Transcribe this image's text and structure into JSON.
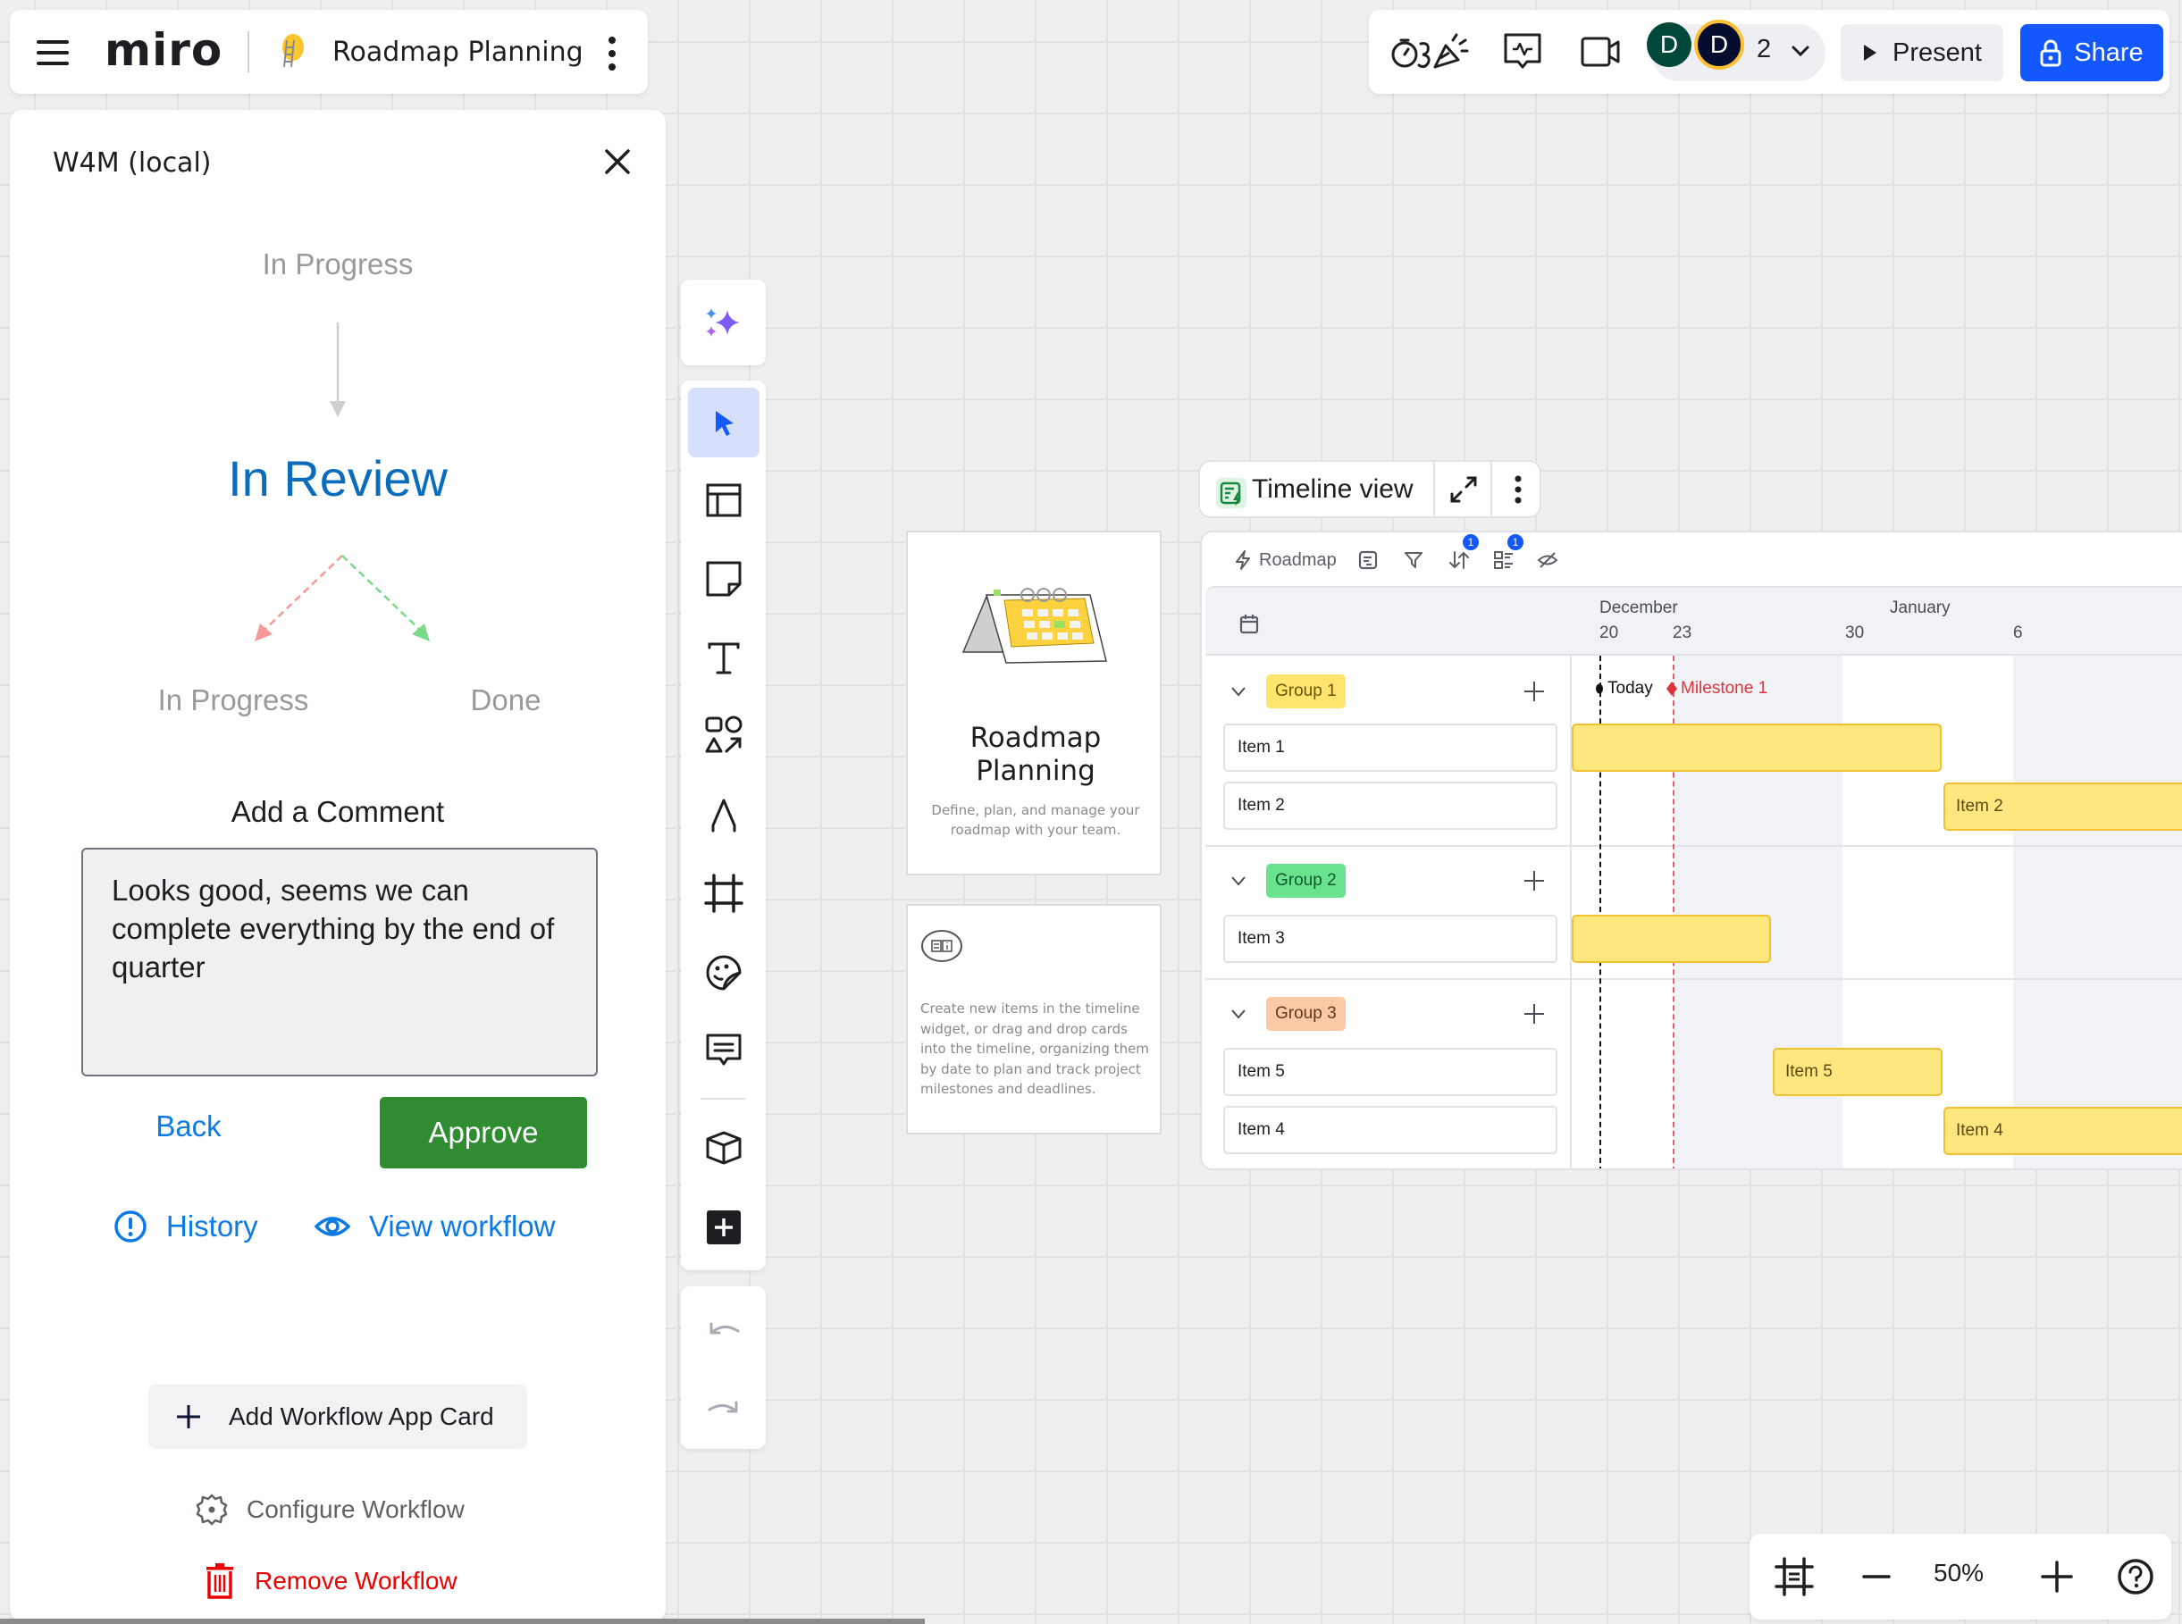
{
  "topbar": {
    "logo": "miro",
    "board_title": "Roadmap Planning"
  },
  "panel": {
    "title": "W4M (local)",
    "previous_state": "In Progress",
    "current_state": "In Review",
    "next_states": [
      {
        "label": "In Progress",
        "color": "#f49a9a"
      },
      {
        "label": "Done",
        "color": "#7bd98a"
      }
    ],
    "comment_label": "Add a Comment",
    "comment_value": "Looks good, seems we can complete everything by the end of quarter",
    "back_label": "Back",
    "approve_label": "Approve",
    "history_label": "History",
    "view_workflow_label": "View workflow",
    "add_card_label": "Add Workflow App Card",
    "configure_label": "Configure Workflow",
    "remove_label": "Remove Workflow",
    "colors": {
      "primary_link": "#0b7ae6",
      "approve": "#2f8c30",
      "danger": "#ee0000",
      "state_active": "#0a6cbd"
    }
  },
  "tools": {
    "ai": "sparkle-icon",
    "items": [
      {
        "name": "select",
        "icon": "pointer-icon",
        "active": true
      },
      {
        "name": "templates",
        "icon": "layout-icon"
      },
      {
        "name": "sticky-note",
        "icon": "sticky-note-icon"
      },
      {
        "name": "text",
        "icon": "text-icon"
      },
      {
        "name": "shapes",
        "icon": "shapes-icon"
      },
      {
        "name": "pen",
        "icon": "pen-icon"
      },
      {
        "name": "frame",
        "icon": "frame-icon"
      },
      {
        "name": "stickers",
        "icon": "sticker-icon"
      },
      {
        "name": "comment",
        "icon": "comment-icon"
      },
      {
        "name": "apps",
        "icon": "cube-icon"
      },
      {
        "name": "more",
        "icon": "plus-square-icon"
      }
    ],
    "undo": "undo-icon",
    "redo": "redo-icon"
  },
  "template_card": {
    "title": "Roadmap Planning",
    "description": "Define, plan, and manage your roadmap with your team."
  },
  "info_card": {
    "text": "Create new items in the timeline widget, or drag and drop cards into the timeline, organizing them by date to plan and track project milestones and deadlines."
  },
  "timeline": {
    "chip_label": "Timeline view",
    "toolbar": {
      "roadmap_label": "Roadmap",
      "sort_badge": "1",
      "group_badge": "1"
    },
    "months": [
      {
        "label": "December",
        "day": 20
      },
      {
        "label": "January",
        "day": 1.5
      }
    ],
    "days": [
      "20",
      "23",
      "30",
      "6"
    ],
    "today_label": "Today",
    "milestone_label": "Milestone 1",
    "groups": [
      {
        "label": "Group 1",
        "bg": "#fde56e",
        "fg": "#6b5200",
        "items": [
          {
            "label": "Item 1",
            "bar_label": "",
            "start": "Dec 17",
            "end": "Dec 31"
          },
          {
            "label": "Item 2",
            "bar_label": "Item 2",
            "start": "Dec 31",
            "end": "Jan 10+"
          }
        ]
      },
      {
        "label": "Group 2",
        "bg": "#6ae38f",
        "fg": "#0f5a2a",
        "items": [
          {
            "label": "Item 3",
            "bar_label": "",
            "start": "Dec 17",
            "end": "Dec 26"
          }
        ]
      },
      {
        "label": "Group 3",
        "bg": "#facaa6",
        "fg": "#6b3418",
        "items": [
          {
            "label": "Item 5",
            "bar_label": "Item 5",
            "start": "Dec 26",
            "end": "Dec 31"
          },
          {
            "label": "Item 4",
            "bar_label": "Item 4",
            "start": "Dec 31",
            "end": "Jan 10+"
          }
        ]
      }
    ]
  },
  "topright": {
    "collaborators": [
      {
        "initial": "D",
        "color": "#00493a"
      },
      {
        "initial": "D",
        "color": "#050c2e"
      }
    ],
    "collaborator_count": "2",
    "present_label": "Present",
    "share_label": "Share",
    "share_color": "#1357ff"
  },
  "zoom": {
    "level": "50%"
  }
}
